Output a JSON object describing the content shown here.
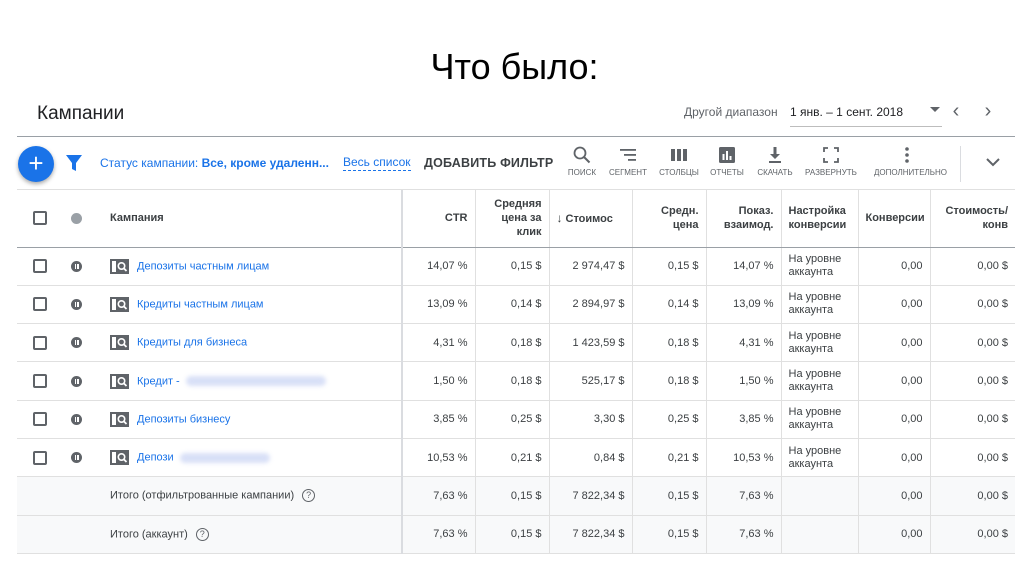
{
  "slide": {
    "title": "Что было:"
  },
  "header": {
    "title": "Кампании",
    "range_label": "Другой диапазон",
    "range_value": "1 янв. – 1 сент. 2018"
  },
  "toolbar": {
    "status_prefix": "Статус кампании: ",
    "status_value": "Все, кроме удаленн...",
    "all_list": "Весь список",
    "add_filter": "ДОБАВИТЬ ФИЛЬТР",
    "tools": [
      {
        "icon": "search-icon",
        "label": "ПОИСК"
      },
      {
        "icon": "segment-icon",
        "label": "СЕГМЕНТ"
      },
      {
        "icon": "columns-icon",
        "label": "СТОЛБЦЫ"
      },
      {
        "icon": "reports-icon",
        "label": "ОТЧЕТЫ"
      },
      {
        "icon": "download-icon",
        "label": "СКАЧАТЬ"
      },
      {
        "icon": "fullscreen-icon",
        "label": "РАЗВЕРНУТЬ"
      },
      {
        "icon": "more-icon",
        "label": "ДОПОЛНИТЕЛЬНО"
      }
    ]
  },
  "table": {
    "headers": {
      "campaign": "Кампания",
      "ctr": "CTR",
      "avg_cpc": "Средняя цена за клик",
      "cost": "Стоимос",
      "avg_price": "Средн. цена",
      "interactions": "Показ. взаимод.",
      "conv_setting": "Настройка конверсии",
      "conversions": "Конверсии",
      "cost_per_conv": "Стоимость/ конв"
    },
    "rows": [
      {
        "name": "Депозиты частным лицам",
        "ctr": "14,07 %",
        "avg_cpc": "0,15 $",
        "cost": "2 974,47 $",
        "avg_price": "0,15 $",
        "interactions": "14,07 %",
        "setting": "На уровне аккаунта",
        "conversions": "0,00",
        "cost_per_conv": "0,00 $"
      },
      {
        "name": "Кредиты частным лицам",
        "ctr": "13,09 %",
        "avg_cpc": "0,14 $",
        "cost": "2 894,97 $",
        "avg_price": "0,14 $",
        "interactions": "13,09 %",
        "setting": "На уровне аккаунта",
        "conversions": "0,00",
        "cost_per_conv": "0,00 $"
      },
      {
        "name": "Кредиты для бизнеса",
        "ctr": "4,31 %",
        "avg_cpc": "0,18 $",
        "cost": "1 423,59 $",
        "avg_price": "0,18 $",
        "interactions": "4,31 %",
        "setting": "На уровне аккаунта",
        "conversions": "0,00",
        "cost_per_conv": "0,00 $"
      },
      {
        "name": "Кредит -",
        "ctr": "1,50 %",
        "avg_cpc": "0,18 $",
        "cost": "525,17 $",
        "avg_price": "0,18 $",
        "interactions": "1,50 %",
        "setting": "На уровне аккаунта",
        "conversions": "0,00",
        "cost_per_conv": "0,00 $"
      },
      {
        "name": "Депозиты бизнесу",
        "ctr": "3,85 %",
        "avg_cpc": "0,25 $",
        "cost": "3,30 $",
        "avg_price": "0,25 $",
        "interactions": "3,85 %",
        "setting": "На уровне аккаунта",
        "conversions": "0,00",
        "cost_per_conv": "0,00 $"
      },
      {
        "name": "Депози",
        "ctr": "10,53 %",
        "avg_cpc": "0,21 $",
        "cost": "0,84 $",
        "avg_price": "0,21 $",
        "interactions": "10,53 %",
        "setting": "На уровне аккаунта",
        "conversions": "0,00",
        "cost_per_conv": "0,00 $"
      }
    ],
    "totals": [
      {
        "label": "Итого (отфильтрованные кампании)",
        "ctr": "7,63 %",
        "avg_cpc": "0,15 $",
        "cost": "7 822,34 $",
        "avg_price": "0,15 $",
        "interactions": "7,63 %",
        "conversions": "0,00",
        "cost_per_conv": "0,00 $"
      },
      {
        "label": "Итого (аккаунт)",
        "ctr": "7,63 %",
        "avg_cpc": "0,15 $",
        "cost": "7 822,34 $",
        "avg_price": "0,15 $",
        "interactions": "7,63 %",
        "conversions": "0,00",
        "cost_per_conv": "0,00 $"
      }
    ]
  }
}
